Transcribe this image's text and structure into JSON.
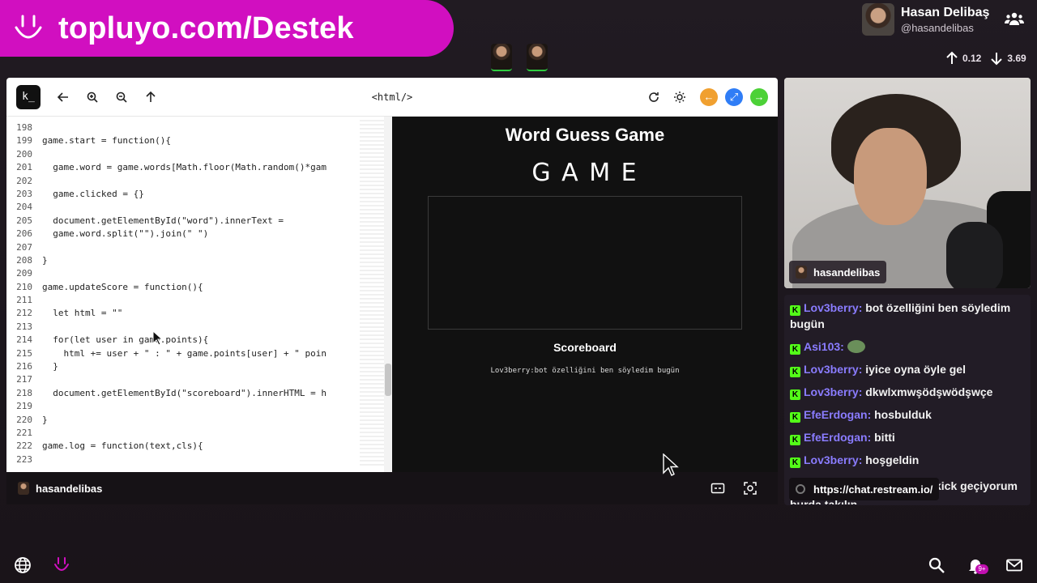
{
  "brand": {
    "text": "topluyo.com/Destek",
    "color": "#d10fc0"
  },
  "profile": {
    "name": "Hasan Delibaş",
    "handle": "@hasandelibas"
  },
  "stats": {
    "up": "0.12",
    "down": "3.69"
  },
  "browser": {
    "logo": "k_",
    "title": "<html/>",
    "code_lines": [
      {
        "n": "198",
        "t": ""
      },
      {
        "n": "199",
        "t": "game.start = function(){"
      },
      {
        "n": "200",
        "t": ""
      },
      {
        "n": "201",
        "t": "  game.word = game.words[Math.floor(Math.random()*gam"
      },
      {
        "n": "202",
        "t": ""
      },
      {
        "n": "203",
        "t": "  game.clicked = {}"
      },
      {
        "n": "204",
        "t": ""
      },
      {
        "n": "205",
        "t": "  document.getElementById(\"word\").innerText ="
      },
      {
        "n": "206",
        "t": "  game.word.split(\"\").join(\" \")"
      },
      {
        "n": "207",
        "t": ""
      },
      {
        "n": "208",
        "t": "}"
      },
      {
        "n": "209",
        "t": ""
      },
      {
        "n": "210",
        "t": "game.updateScore = function(){"
      },
      {
        "n": "211",
        "t": ""
      },
      {
        "n": "212",
        "t": "  let html = \"\""
      },
      {
        "n": "213",
        "t": ""
      },
      {
        "n": "214",
        "t": "  for(let user in game.points){"
      },
      {
        "n": "215",
        "t": "    html += user + \" : \" + game.points[user] + \" poin"
      },
      {
        "n": "216",
        "t": "  }"
      },
      {
        "n": "217",
        "t": ""
      },
      {
        "n": "218",
        "t": "  document.getElementById(\"scoreboard\").innerHTML = h"
      },
      {
        "n": "219",
        "t": ""
      },
      {
        "n": "220",
        "t": "}"
      },
      {
        "n": "221",
        "t": ""
      },
      {
        "n": "222",
        "t": "game.log = function(text,cls){"
      },
      {
        "n": "223",
        "t": ""
      }
    ],
    "preview": {
      "title": "Word Guess Game",
      "word": "G A M E",
      "scoreboard_title": "Scoreboard",
      "scoreboard_entry": "Lov3berry:bot özelliğini ben söyledim bugün"
    }
  },
  "window_user": "hasandelibas",
  "cam_user": "hasandelibas",
  "chat": {
    "messages": [
      {
        "user": "Lov3berry:",
        "text": " bot özelliğini ben söyledim bugün"
      },
      {
        "user": "Asi103:",
        "text": ""
      },
      {
        "user": "Lov3berry:",
        "text": " iyice oyna öyle gel"
      },
      {
        "user": "Lov3berry:",
        "text": " dkwlxmwşödşwödşwçe"
      },
      {
        "user": "EfeErdogan:",
        "text": " hosbulduk"
      },
      {
        "user": "EfeErdogan:",
        "text": " bitti"
      },
      {
        "user": "Lov3berry:",
        "text": " hoşgeldin"
      }
    ],
    "link": "https://chat.restream.io/",
    "tail": "kick geçiyorum",
    "cut": "burda takılın"
  },
  "notifications_badge": "9+"
}
